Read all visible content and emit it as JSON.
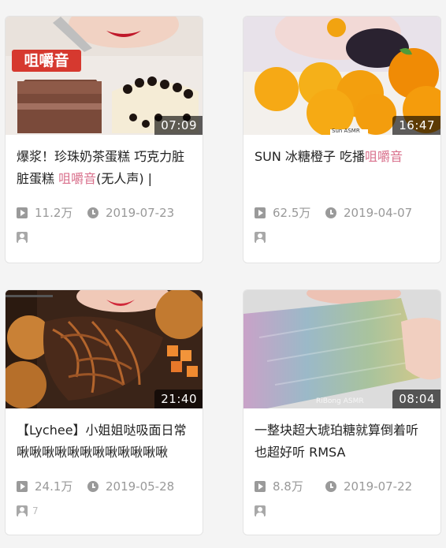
{
  "videos": [
    {
      "duration": "07:09",
      "title_pre": "爆浆！珍珠奶茶蛋糕 巧克力脏脏蛋糕 ",
      "title_hl": "咀嚼音",
      "title_post": "(无人声) |",
      "views": "11.2万",
      "date": "2019-07-23",
      "thumb_overlay": "咀嚼音",
      "author": ""
    },
    {
      "duration": "16:47",
      "title_pre": "SUN 冰糖橙子 吃播",
      "title_hl": "咀嚼音",
      "title_post": "",
      "views": "62.5万",
      "date": "2019-04-07",
      "thumb_overlay": "Sun ASMR",
      "author": ""
    },
    {
      "duration": "21:40",
      "title_pre": "【Lychee】小姐姐哒吸面日常啾啾啾啾啾啾啾啾啾啾啾啾",
      "title_hl": "",
      "title_post": "",
      "views": "24.1万",
      "date": "2019-05-28",
      "thumb_overlay": "",
      "author": "7"
    },
    {
      "duration": "08:04",
      "title_pre": "一整块超大琥珀糖就算倒着听也超好听 RMSA",
      "title_hl": "",
      "title_post": "",
      "views": "8.8万",
      "date": "2019-07-22",
      "thumb_overlay": "RiBong ASMR",
      "author": ""
    }
  ],
  "colors": {
    "highlight": "#d9708c",
    "meta_text": "#999999",
    "duration_bg": "rgba(0,0,0,0.62)"
  }
}
